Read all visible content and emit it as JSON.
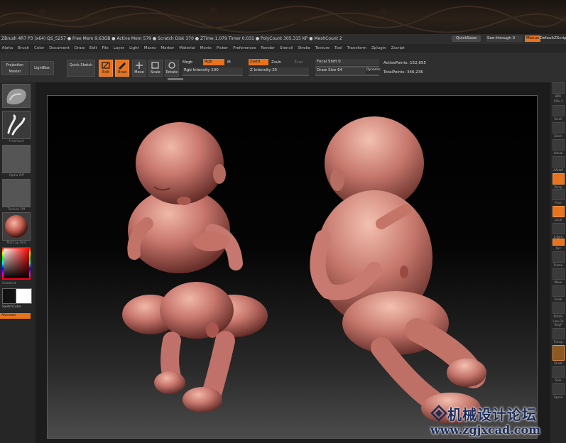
{
  "titlebar": {
    "info": "ZBrush 4R7 P3 (x64)   QS_5257   ● Free Mem 9.63GB ● Active Mem 579 ● Scratch Disk 370 ● ZTime 1.079 Timer 0.031 ● PolyCount 305.315 KP ● MeshCount 2",
    "quicksave": "QuickSave",
    "seethrough": "See-through  0",
    "menus": "Menus",
    "default_script": "DefaultZScript"
  },
  "menubar": [
    "Alpha",
    "Brush",
    "Color",
    "Document",
    "Draw",
    "Edit",
    "File",
    "Layer",
    "Light",
    "Macro",
    "Marker",
    "Material",
    "Movie",
    "Picker",
    "Preferences",
    "Render",
    "Stencil",
    "Stroke",
    "Texture",
    "Tool",
    "Transform",
    "Zplugin",
    "Zscript"
  ],
  "toolbar": {
    "projection_master": "Projection Master",
    "lightbox": "LightBox",
    "quick_sketch": "Quick Sketch",
    "edit": "Edit",
    "draw": "Draw",
    "move": "Move",
    "scale": "Scale",
    "rotate": "Rotate",
    "mrgb": "Mrgb",
    "rgb": "Rgb",
    "m": "M",
    "zadd": "Zadd",
    "zsub": "Zsub",
    "zcut": "Zcut",
    "rgb_intensity": "Rgb Intensity 100",
    "z_intensity": "Z Intensity 25",
    "focal_shift": "Focal Shift 0",
    "draw_size": "Draw Size 64",
    "dynamic": "Dynamic",
    "active_points": "ActivePoints: 152,655",
    "total_points": "TotalPoints: 346,236"
  },
  "leftpanel": {
    "stroke_label": "Freehand",
    "alpha_label": "Alpha Off",
    "texture_label": "Texture Off",
    "material_label": "MatCap Red",
    "gradient_label": "Gradient",
    "switch_color": "SwitchColor",
    "alternate": "Alternate"
  },
  "rightpanel": {
    "labels": [
      "BPR",
      "SPix 3",
      "Scroll",
      "Zoom",
      "Actual",
      "AAHalf",
      "Persp",
      "Floor",
      "Local",
      "L.Sym",
      "Xyz",
      "Frame",
      "Move",
      "Scale",
      "Rotate",
      "Line Fill PolyF",
      "Transp",
      "Ghost",
      "Solo",
      "Xpose"
    ]
  },
  "watermark": {
    "cn_text": "机械设计论坛",
    "url": "www.zgjxcad.com"
  },
  "colors": {
    "accent": "#e8731e",
    "skin": "#c9786e",
    "panel": "#2f2f2f"
  }
}
